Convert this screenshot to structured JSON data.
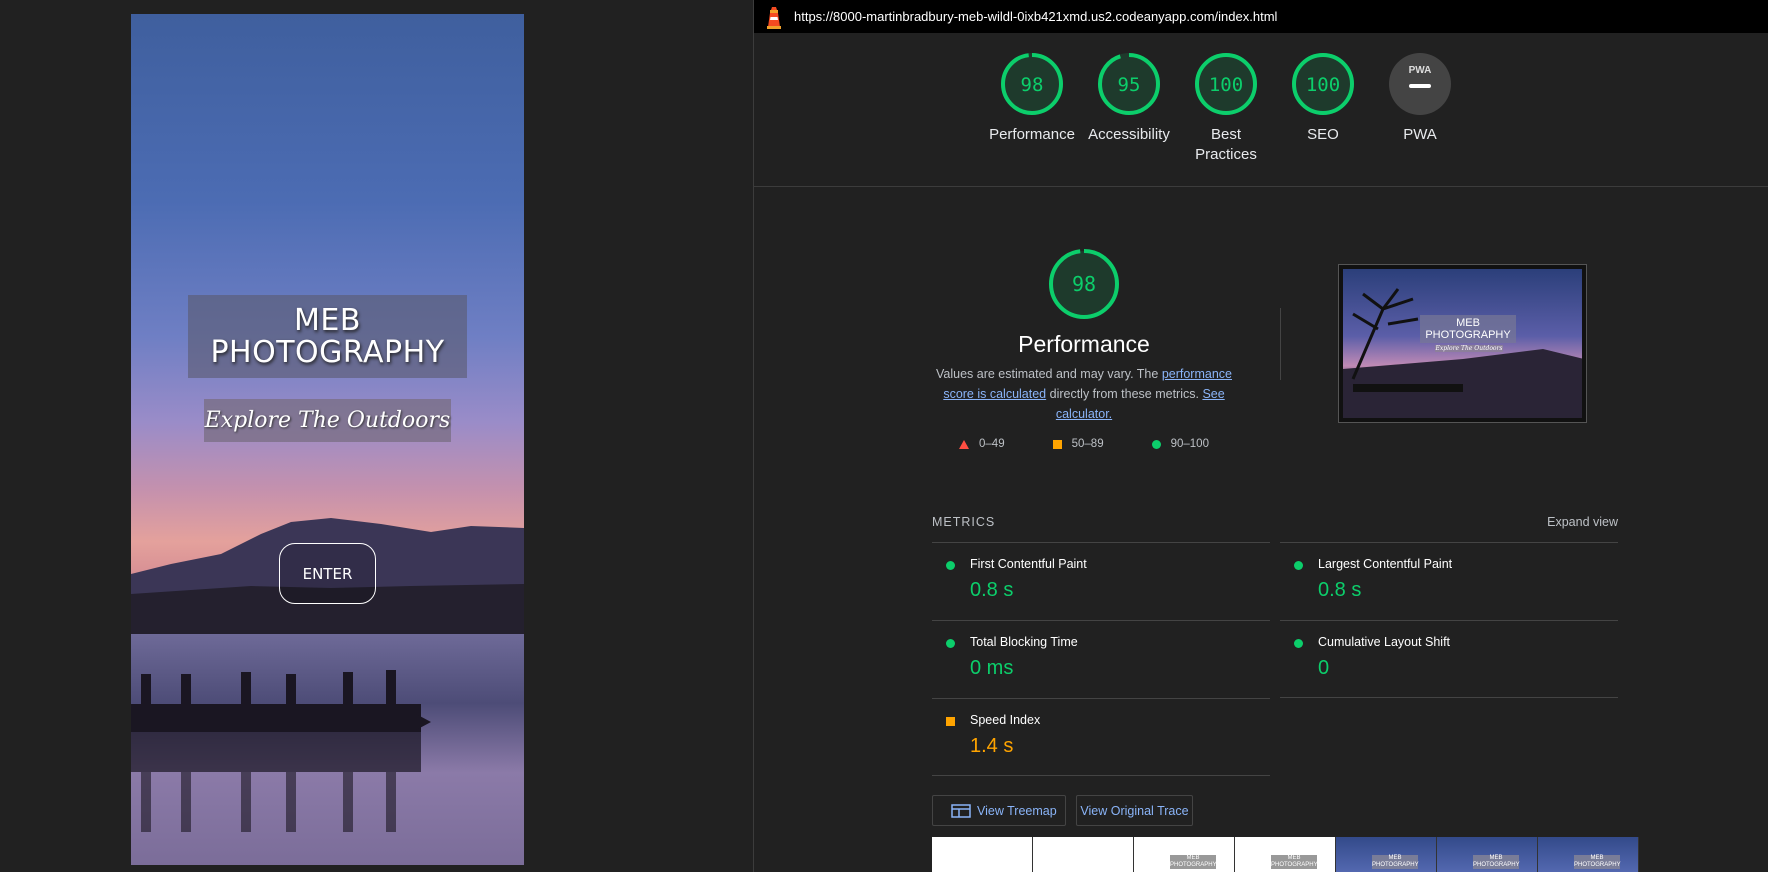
{
  "preview": {
    "title": "MEB\nPHOTOGRAPHY",
    "tagline": "Explore The Outdoors",
    "enter_label": "ENTER"
  },
  "report": {
    "url": "https://8000-martinbradbury-meb-wildl-0ixb421xmd.us2.codeanyapp.com/index.html",
    "gauges": [
      {
        "score": "98",
        "label": "Performance",
        "value": 98
      },
      {
        "score": "95",
        "label": "Accessibility",
        "value": 95
      },
      {
        "score": "100",
        "label": "Best\nPractices",
        "value": 100
      },
      {
        "score": "100",
        "label": "SEO",
        "value": 100
      },
      {
        "score": "PWA",
        "label": "PWA"
      }
    ],
    "performance": {
      "score": "98",
      "value": 98,
      "title": "Performance",
      "desc_prefix": "Values are estimated and may vary. The ",
      "desc_link1": "performance score is calculated",
      "desc_middle": " directly from these metrics. ",
      "desc_link2": "See calculator.",
      "legend": [
        "0–49",
        "50–89",
        "90–100"
      ]
    },
    "thumbnail": {
      "title": "MEB\nPHOTOGRAPHY",
      "tagline": "Explore The Outdoors"
    },
    "metrics_label": "METRICS",
    "expand_label": "Expand view",
    "metrics": [
      {
        "name": "First Contentful Paint",
        "value": "0.8 s",
        "status": "green"
      },
      {
        "name": "Largest Contentful Paint",
        "value": "0.8 s",
        "status": "green"
      },
      {
        "name": "Total Blocking Time",
        "value": "0 ms",
        "status": "green"
      },
      {
        "name": "Cumulative Layout Shift",
        "value": "0",
        "status": "green"
      },
      {
        "name": "Speed Index",
        "value": "1.4 s",
        "status": "orange"
      }
    ],
    "buttons": {
      "treemap": "View Treemap",
      "trace": "View Original Trace"
    },
    "filmstrip_text": "MEB\nPHOTOGRAPHY"
  },
  "colors": {
    "pass": "#0cce6b",
    "average": "#ffa400",
    "fail": "#ff4e42",
    "link": "#8ab4f8",
    "background": "#212121"
  }
}
